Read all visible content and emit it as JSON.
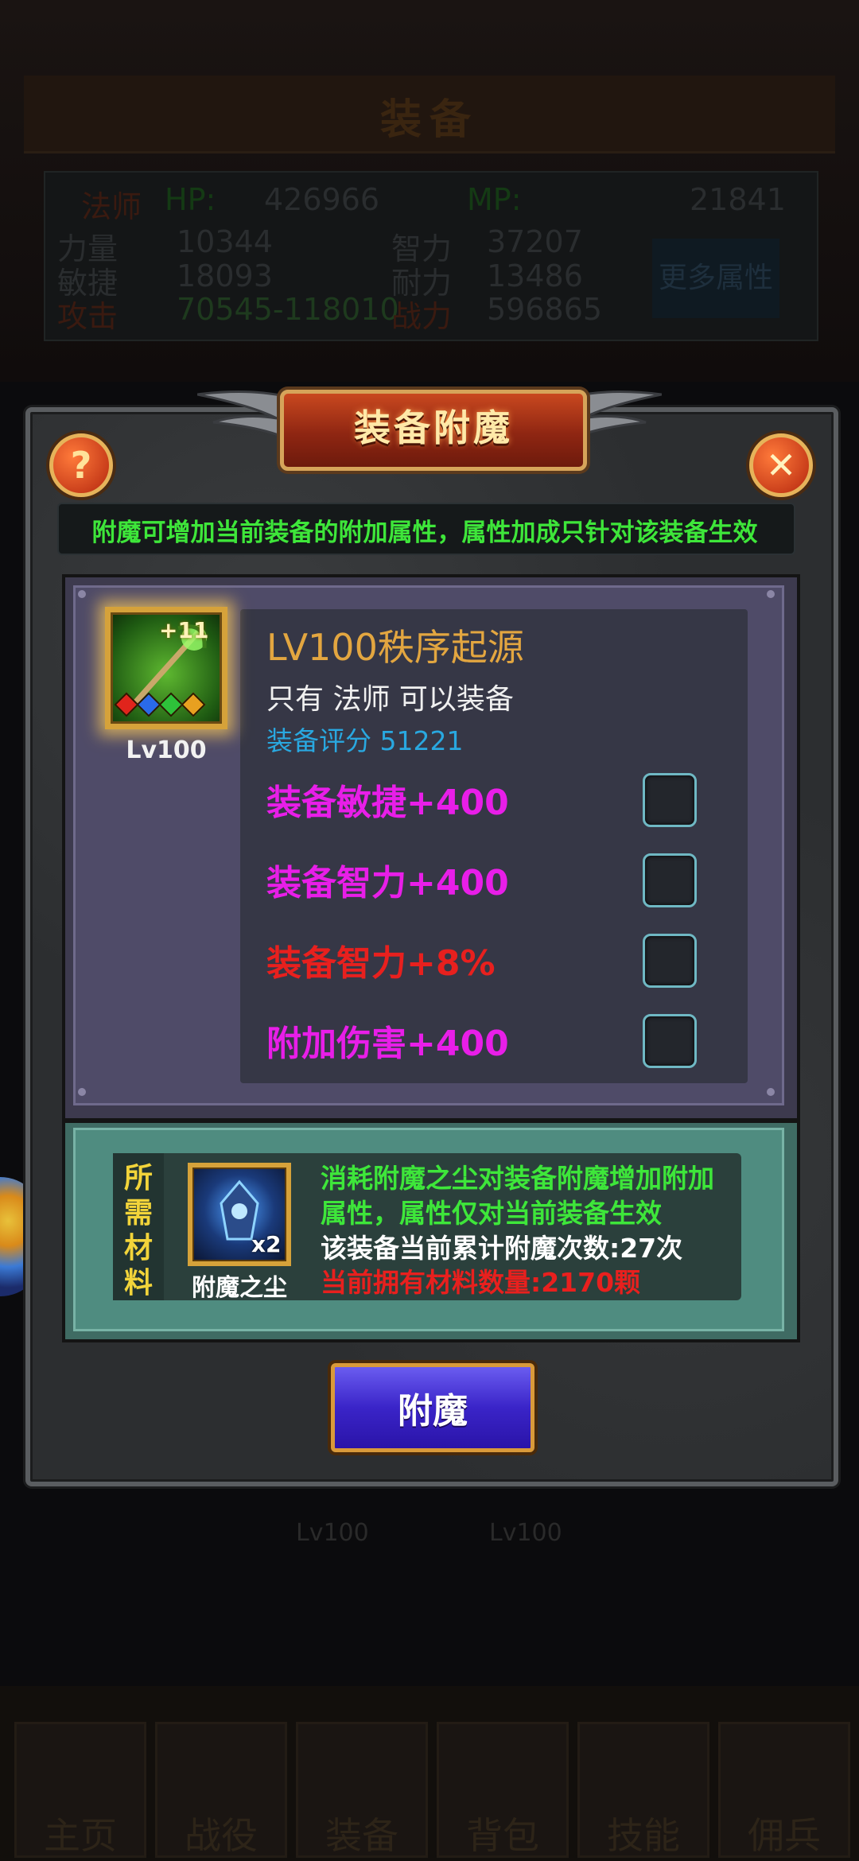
{
  "background": {
    "title": "装备",
    "stats": {
      "class_label": "法师",
      "hp_label": "HP:",
      "hp_value": "426966",
      "mp_label": "MP:",
      "mp_value": "21841",
      "str_label": "力量",
      "str_value": "10344",
      "int_label": "智力",
      "int_value": "37207",
      "agi_label": "敏捷",
      "agi_value": "18093",
      "sta_label": "耐力",
      "sta_value": "13486",
      "atk_label": "攻击",
      "atk_value": "70545-118010",
      "def_label": "战力",
      "def_value": "596865",
      "more_button": "更多属性"
    },
    "item_levels": [
      "Lv100",
      "Lv100"
    ],
    "nav": [
      "主页",
      "战役",
      "装备",
      "背包",
      "技能",
      "佣兵"
    ]
  },
  "dialog": {
    "title": "装备附魔",
    "help_icon": "?",
    "close_icon": "✕",
    "tip": "附魔可增加当前装备的附加属性，属性加成只针对该装备生效",
    "item": {
      "plus": "+11",
      "level": "Lv100",
      "name": "LV100秩序起源",
      "class_req": "只有 法师 可以装备",
      "score_label": "装备评分",
      "score_value": "51221",
      "gems": [
        "#e0241c",
        "#2a6ae8",
        "#2ec23a",
        "#e8a020"
      ]
    },
    "attributes": [
      {
        "text": "装备敏捷+400",
        "color": "#e81ee8",
        "checked": false
      },
      {
        "text": "装备智力+400",
        "color": "#e81ee8",
        "checked": false
      },
      {
        "text": "装备智力+8%",
        "color": "#e8201e",
        "checked": false
      },
      {
        "text": "附加伤害+400",
        "color": "#e81ee8",
        "checked": false
      }
    ],
    "material": {
      "label_chars": [
        "所",
        "需",
        "材",
        "料"
      ],
      "count": "x2",
      "name": "附魔之尘",
      "desc_line1": "消耗附魔之尘对装备附魔增加附加",
      "desc_line2": "属性，属性仅对当前装备生效",
      "enchant_count": "该装备当前累计附魔次数:27次",
      "owned": "当前拥有材料数量:2170颗"
    },
    "action_button": "附魔"
  },
  "colors": {
    "tip_green": "#3ee63a",
    "item_name_gold": "#e3a640",
    "score_blue": "#29a8e0",
    "magenta": "#e81ee8",
    "red": "#e8201e",
    "material_label_yellow": "#f2d43a"
  }
}
